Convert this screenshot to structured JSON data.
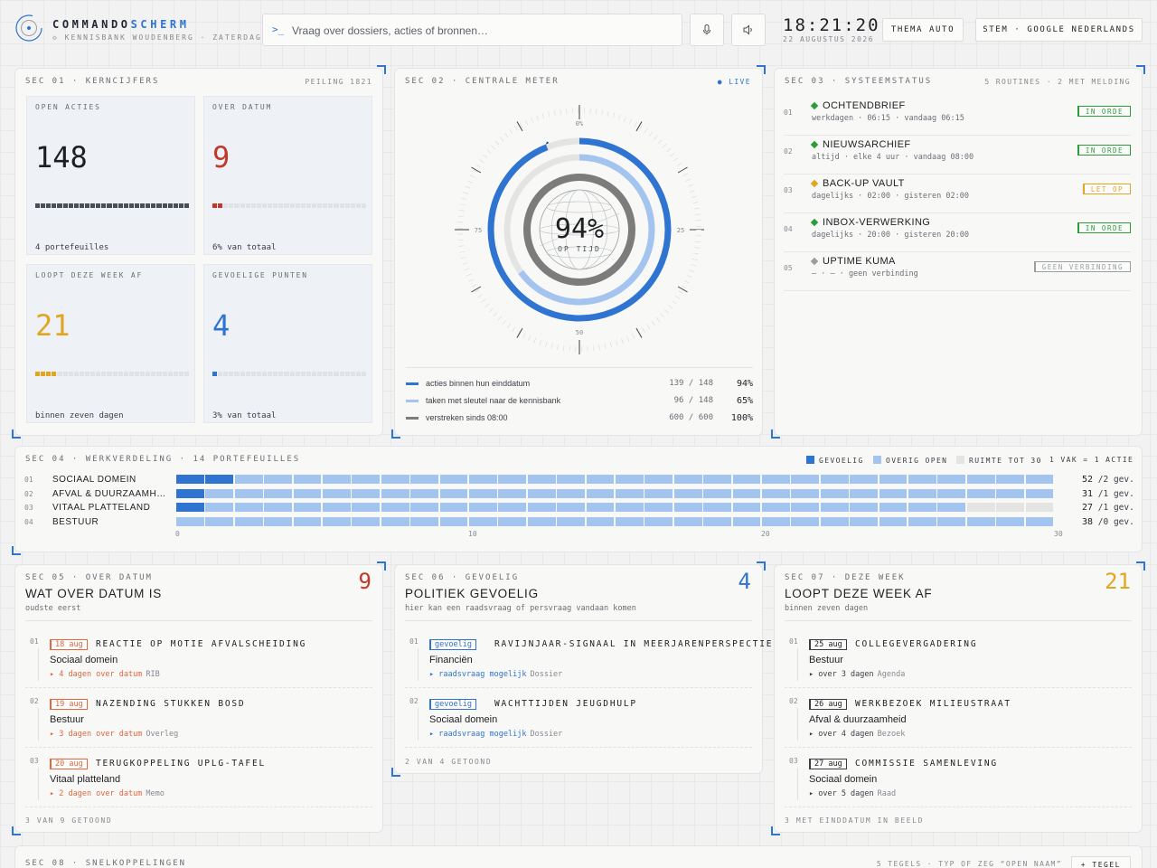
{
  "header": {
    "brand_main": "COMMANDO",
    "brand_accent": "SCHERM",
    "brand_sub": "◇ KENNISBANK WOUDENBERG · ZATERDAG",
    "search_prompt": ">_",
    "search_placeholder": "Vraag over dossiers, acties of bronnen…",
    "mic_icon": "microphone-icon",
    "speaker_icon": "speaker-icon",
    "time": "18:21:20",
    "date": "22 AUGUSTUS 2026",
    "theme_button": "THEMA AUTO",
    "voice_button": "STEM · GOOGLE NEDERLANDS"
  },
  "kpi": {
    "sec_label": "SEC 01 · KERNCIJFERS",
    "sec_right": "PEILING 1821",
    "tiles": [
      {
        "label": "OPEN ACTIES",
        "value": "148",
        "foot": "4 portefeuilles",
        "color": "#1d1f22",
        "bar_fill": 1.0
      },
      {
        "label": "OVER DATUM",
        "value": "9",
        "foot": "6% van totaal",
        "color": "#c0392b",
        "bar_fill": 0.06
      },
      {
        "label": "LOOPT DEZE WEEK AF",
        "value": "21",
        "foot": "binnen zeven dagen",
        "color": "#e0a620",
        "bar_fill": 0.14
      },
      {
        "label": "GEVOELIGE PUNTEN",
        "value": "4",
        "foot": "3% van totaal",
        "color": "#2f74d0",
        "bar_fill": 0.03
      }
    ]
  },
  "gauge": {
    "sec_label": "SEC 02 · CENTRALE METER",
    "live_label": "● LIVE",
    "center_value": "94%",
    "center_sub": "OP TIJD",
    "tick_labels": {
      "top": "0%",
      "right": "25",
      "bottom": "50",
      "left": "75"
    },
    "rings": [
      {
        "label": "acties binnen hun einddatum",
        "ratio": "139 / 148",
        "pct": "94%",
        "fraction": 0.94,
        "color": "#2f74d0"
      },
      {
        "label": "taken met sleutel naar de kennisbank",
        "ratio": "96 / 148",
        "pct": "65%",
        "fraction": 0.65,
        "color": "#a3c4ee"
      },
      {
        "label": "verstreken sinds 08:00",
        "ratio": "600 / 600",
        "pct": "100%",
        "fraction": 1.0,
        "color": "#7c7c7c"
      }
    ]
  },
  "status": {
    "sec_label": "SEC 03 · SYSTEEMSTATUS",
    "sec_right": "5 ROUTINES · 2 MET MELDING",
    "items": [
      {
        "idx": "01",
        "name": "OCHTENDBRIEF",
        "sub": "werkdagen · 06:15 · vandaag 06:15",
        "badge": "IN ORDE",
        "color": "#2a9d3a"
      },
      {
        "idx": "02",
        "name": "NIEUWSARCHIEF",
        "sub": "altijd · elke 4 uur · vandaag 08:00",
        "badge": "IN ORDE",
        "color": "#2a9d3a"
      },
      {
        "idx": "03",
        "name": "BACK-UP VAULT",
        "sub": "dagelijks · 02:00 · gisteren 02:00",
        "badge": "LET OP",
        "color": "#e0a620"
      },
      {
        "idx": "04",
        "name": "INBOX-VERWERKING",
        "sub": "dagelijks · 20:00 · gisteren 20:00",
        "badge": "IN ORDE",
        "color": "#2a9d3a"
      },
      {
        "idx": "05",
        "name": "UPTIME KUMA",
        "sub": "— · — · geen verbinding",
        "badge": "GEEN VERBINDING",
        "color": "#9a9ea3"
      }
    ]
  },
  "workload": {
    "sec_label": "SEC 04 · WERKVERDELING · 14 PORTEFEUILLES",
    "legend": [
      "GEVOELIG",
      "OVERIG OPEN",
      "RUIMTE TOT 30",
      "1 VAK = 1 ACTIE"
    ],
    "legend_colors": [
      "#2f74d0",
      "#a3c4ee",
      "#e4e4e2"
    ],
    "axis": [
      "0",
      "10",
      "20",
      "30"
    ],
    "rows": [
      {
        "idx": "01",
        "name": "SOCIAAL DOMEIN",
        "total": "52",
        "gev": "/2 gev.",
        "sensitive": 2,
        "open": 28
      },
      {
        "idx": "02",
        "name": "AFVAL & DUURZAAMHEID",
        "total": "31",
        "gev": "/1 gev.",
        "sensitive": 1,
        "open": 29
      },
      {
        "idx": "03",
        "name": "VITAAL PLATTELAND",
        "total": "27",
        "gev": "/1 gev.",
        "sensitive": 1,
        "open": 26
      },
      {
        "idx": "04",
        "name": "BESTUUR",
        "total": "38",
        "gev": "/0 gev.",
        "sensitive": 0,
        "open": 30
      }
    ]
  },
  "overdue": {
    "sec_label": "SEC 05 · OVER DATUM",
    "title": "WAT OVER DATUM IS",
    "sub": "oudste eerst",
    "count": "9",
    "footer": "3 VAN 9 GETOOND",
    "items": [
      {
        "idx": "01",
        "date": "18 aug",
        "title": "REACTIE OP MOTIE AFVALSCHEIDING",
        "cat": "Sociaal domein",
        "meta": "▸ 4 dagen over datum",
        "tag": "RIB"
      },
      {
        "idx": "02",
        "date": "19 aug",
        "title": "NAZENDING STUKKEN BOSD",
        "cat": "Bestuur",
        "meta": "▸ 3 dagen over datum",
        "tag": "Overleg"
      },
      {
        "idx": "03",
        "date": "20 aug",
        "title": "TERUGKOPPELING UPLG-TAFEL",
        "cat": "Vitaal platteland",
        "meta": "▸ 2 dagen over datum",
        "tag": "Memo"
      }
    ]
  },
  "sensitive": {
    "sec_label": "SEC 06 · GEVOELIG",
    "title": "POLITIEK GEVOELIG",
    "sub": "hier kan een raadsvraag of persvraag vandaan komen",
    "count": "4",
    "footer": "2 VAN 4 GETOOND",
    "items": [
      {
        "idx": "01",
        "date": "gevoelig",
        "title": "RAVIJNJAAR-SIGNAAL IN MEERJARENPERSPECTIEF",
        "cat": "Financiën",
        "meta": "▸ raadsvraag mogelijk",
        "tag": "Dossier"
      },
      {
        "idx": "02",
        "date": "gevoelig",
        "title": "WACHTTIJDEN JEUGDHULP",
        "cat": "Sociaal domein",
        "meta": "▸ raadsvraag mogelijk",
        "tag": "Dossier"
      }
    ]
  },
  "thisweek": {
    "sec_label": "SEC 07 · DEZE WEEK",
    "title": "LOOPT DEZE WEEK AF",
    "sub": "binnen zeven dagen",
    "count": "21",
    "footer": "3 MET EINDDATUM IN BEELD",
    "items": [
      {
        "idx": "01",
        "date": "25 aug",
        "title": "COLLEGEVERGADERING",
        "cat": "Bestuur",
        "meta": "▸ over 3 dagen",
        "tag": "Agenda"
      },
      {
        "idx": "02",
        "date": "26 aug",
        "title": "WERKBEZOEK MILIEUSTRAAT",
        "cat": "Afval & duurzaamheid",
        "meta": "▸ over 4 dagen",
        "tag": "Bezoek"
      },
      {
        "idx": "03",
        "date": "27 aug",
        "title": "COMMISSIE SAMENLEVING",
        "cat": "Sociaal domein",
        "meta": "▸ over 5 dagen",
        "tag": "Raad"
      }
    ]
  },
  "quicklinks": {
    "sec_label": "SEC 08 · SNELKOPPELINGEN",
    "sec_right": "5 TEGELS · TYP OF ZEG “OPEN NAAM”",
    "add_button": "+ TEGEL"
  }
}
